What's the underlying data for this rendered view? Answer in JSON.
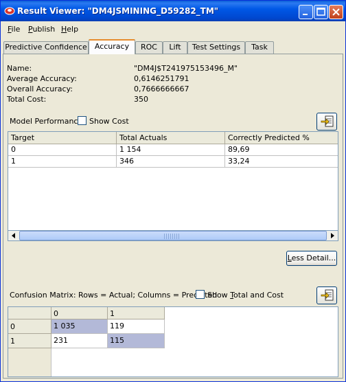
{
  "window": {
    "title": "Result Viewer: \"DM4JSMINING_D59282_TM\"",
    "accent": "#0058e6"
  },
  "menu": [
    {
      "label": "File",
      "mnemonic": "F",
      "rest": "ile"
    },
    {
      "label": "Publish",
      "mnemonic": "P",
      "rest": "ublish"
    },
    {
      "label": "Help",
      "mnemonic": "H",
      "rest": "elp"
    }
  ],
  "tabs": [
    {
      "label": "Predictive Confidence"
    },
    {
      "label": "Accuracy",
      "active": true
    },
    {
      "label": "ROC"
    },
    {
      "label": "Lift"
    },
    {
      "label": "Test Settings"
    },
    {
      "label": "Task"
    }
  ],
  "info": {
    "name_label": "Name:",
    "name_value": "\"DM4J$T241975153496_M\"",
    "avg_label": "Average Accuracy:",
    "avg_value": "0,6146251791",
    "overall_label": "Overall Accuracy:",
    "overall_value": "0,7666666667",
    "cost_label": "Total Cost:",
    "cost_value": "350"
  },
  "model_performance": {
    "label": "Model Performance",
    "show_cost_label": "Show Cost",
    "columns": [
      "Target",
      "Total Actuals",
      "Correctly Predicted %"
    ],
    "rows": [
      [
        "0",
        "1 154",
        "89,69"
      ],
      [
        "1",
        "346",
        "33,24"
      ]
    ]
  },
  "less_detail_button": "Less Detail...",
  "confusion": {
    "label": "Confusion Matrix:  Rows = Actual; Columns = Predicted",
    "show_total_label": "Show Total and Cost",
    "col_headers": [
      "0",
      "1"
    ],
    "row_headers": [
      "0",
      "1"
    ],
    "cells": [
      [
        "1 035",
        "119"
      ],
      [
        "231",
        "115"
      ]
    ],
    "diag_color": "#b3b9d8"
  }
}
